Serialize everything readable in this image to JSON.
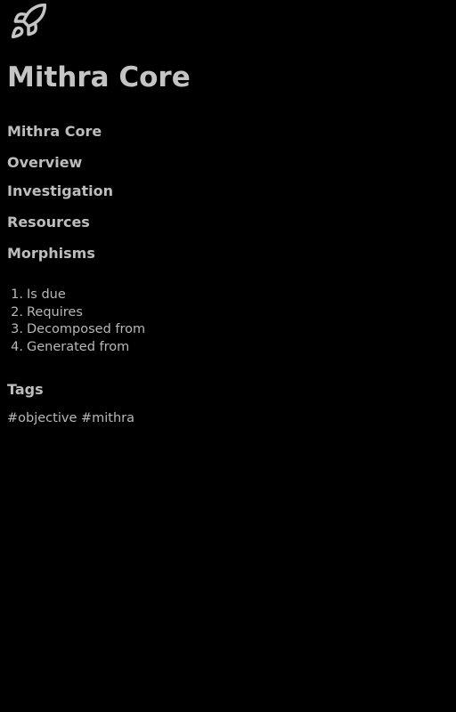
{
  "header": {
    "icon": "rocket-icon",
    "title": "Mithra Core"
  },
  "nav": {
    "core": "Mithra Core",
    "overview": "Overview",
    "investigation": "Investigation",
    "resources": "Resources",
    "morphisms": "Morphisms"
  },
  "morphisms": [
    {
      "num": "1.",
      "label": "Is due"
    },
    {
      "num": "2.",
      "label": "Requires"
    },
    {
      "num": "3.",
      "label": "Decomposed from"
    },
    {
      "num": "4.",
      "label": "Generated from"
    }
  ],
  "tags": {
    "heading": "Tags",
    "items": [
      "#objective",
      "#mithra"
    ]
  },
  "colors": {
    "background": "#000000",
    "text": "#bdbdbd"
  }
}
